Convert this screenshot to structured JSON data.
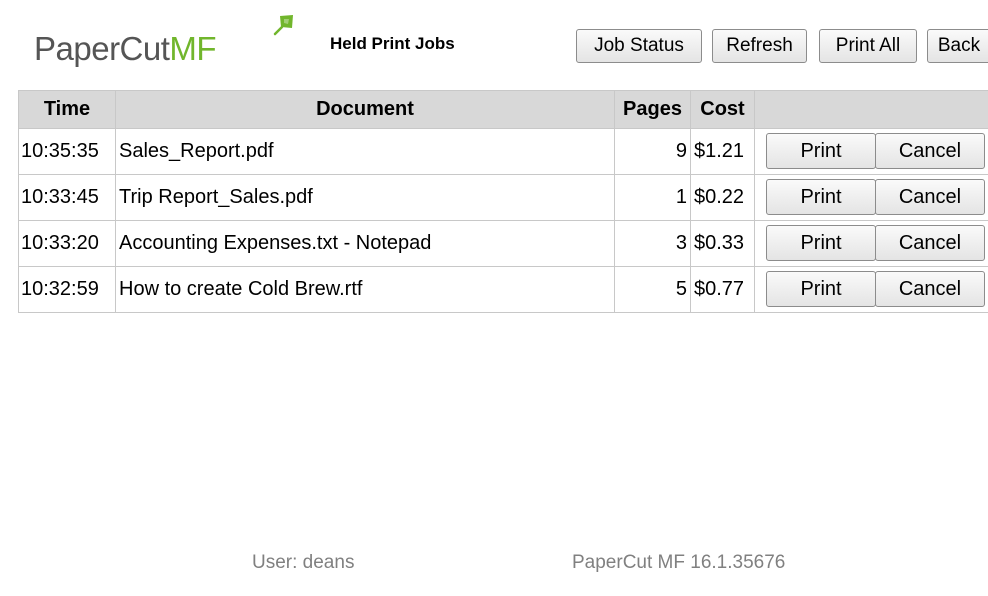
{
  "app": {
    "brand_main": "PaperCut",
    "brand_suffix": "MF",
    "title": "Held Print Jobs"
  },
  "toolbar": {
    "job_status": "Job Status",
    "refresh": "Refresh",
    "print_all": "Print All",
    "back": "Back"
  },
  "table": {
    "headers": {
      "time": "Time",
      "document": "Document",
      "pages": "Pages",
      "cost": "Cost",
      "actions": ""
    },
    "rows": [
      {
        "time": "10:35:35",
        "document": "Sales_Report.pdf",
        "pages": "9",
        "cost": "$1.21",
        "print_label": "Print",
        "cancel_label": "Cancel"
      },
      {
        "time": "10:33:45",
        "document": "Trip Report_Sales.pdf",
        "pages": "1",
        "cost": "$0.22",
        "print_label": "Print",
        "cancel_label": "Cancel"
      },
      {
        "time": "10:33:20",
        "document": "Accounting Expenses.txt - Notepad",
        "pages": "3",
        "cost": "$0.33",
        "print_label": "Print",
        "cancel_label": "Cancel"
      },
      {
        "time": "10:32:59",
        "document": "How to create Cold Brew.rtf",
        "pages": "5",
        "cost": "$0.77",
        "print_label": "Print",
        "cancel_label": "Cancel"
      }
    ]
  },
  "footer": {
    "user": "User: deans",
    "version": "PaperCut MF 16.1.35676"
  },
  "colors": {
    "brand_gray": "#555555",
    "brand_green": "#71b62c",
    "header_bg": "#d8d8d8",
    "footer_text": "#808080"
  },
  "icons": {
    "logo_leaf": "papercut-leaf-icon"
  }
}
